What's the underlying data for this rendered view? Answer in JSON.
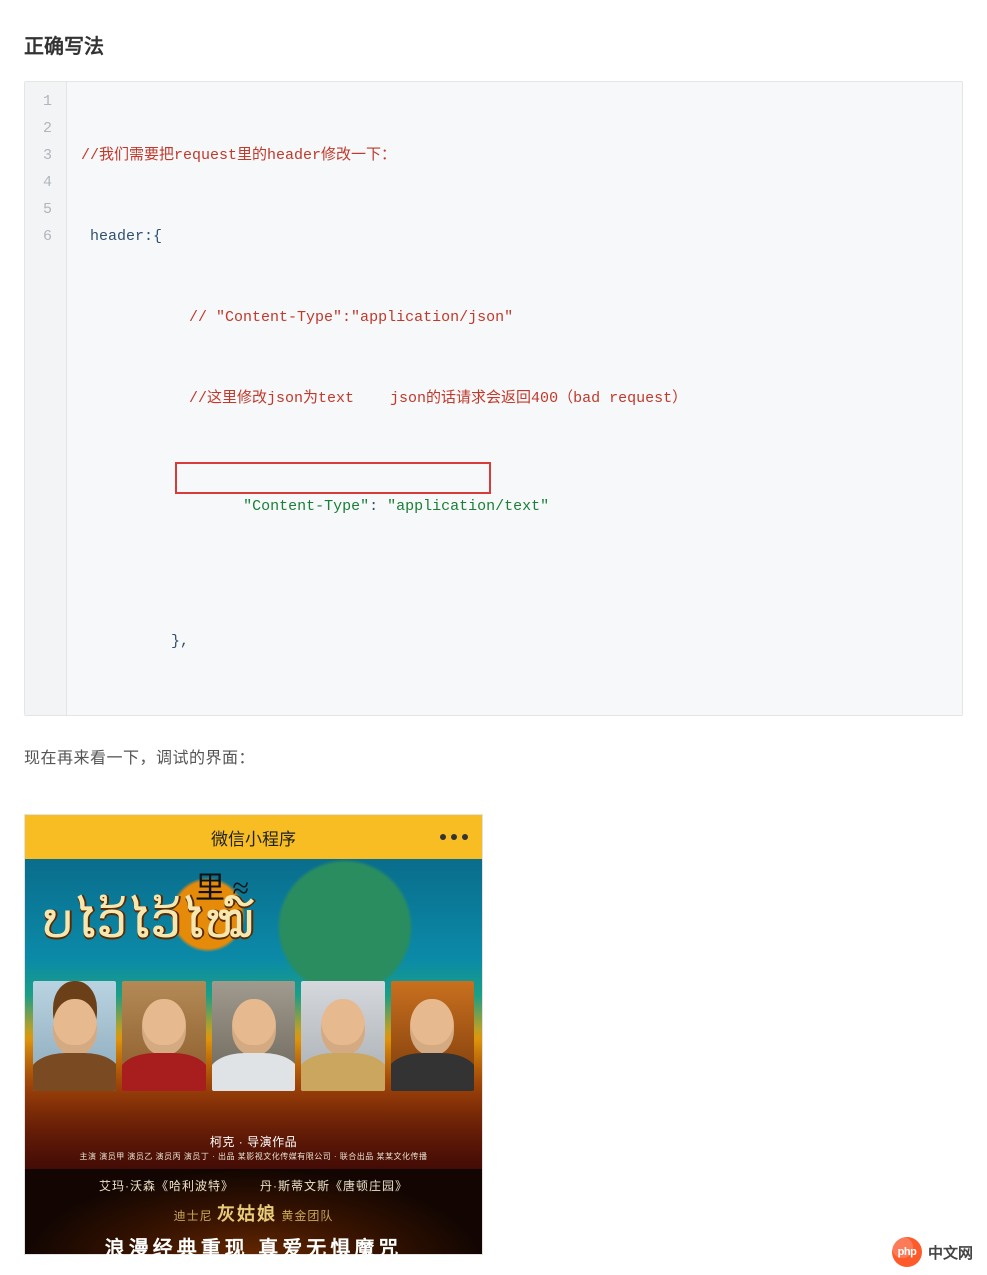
{
  "heading": "正确写法",
  "code": {
    "lines": [
      "1",
      "2",
      "3",
      "4",
      "5",
      "6"
    ],
    "l1_a": "//我们需要把request里的header修改一下：",
    "l2_a": " header:{",
    "l3_a": "            // \"Content-Type\":\"application/json\"",
    "l4_a": "            //这里修改json为text    json的话请求会返回400（bad request）",
    "l5_a": "            ",
    "l5_key": "\"Content-Type\"",
    "l5_colon": ": ",
    "l5_val": "\"application/text\"",
    "l6_a": "          },"
  },
  "paragraph": "现在再来看一下，调试的界面：",
  "phone": {
    "title": "微信小程序",
    "script_glyphs": "ບໄວ້ໄວ້ໄໝ໌",
    "top_ideogram": "里 ≈",
    "credit_main": "柯克 · 导演作品",
    "credit_small": "主演 演员甲 演员乙 演员丙 演员丁 · 出品 某影视文化传媒有限公司 · 联合出品 某某文化传播",
    "p2_top_left": "艾玛·沃森《哈利波特》",
    "p2_top_right": "丹·斯蒂文斯《唐顿庄园》",
    "p2_mid_prefix": "迪士尼 ",
    "p2_mid_big": "灰姑娘",
    "p2_mid_suffix": " 黄金团队",
    "p2_bottom": "浪漫经典重现  真爱无惧魔咒"
  },
  "watermark": {
    "logo_text": "php",
    "label": "中文网"
  }
}
